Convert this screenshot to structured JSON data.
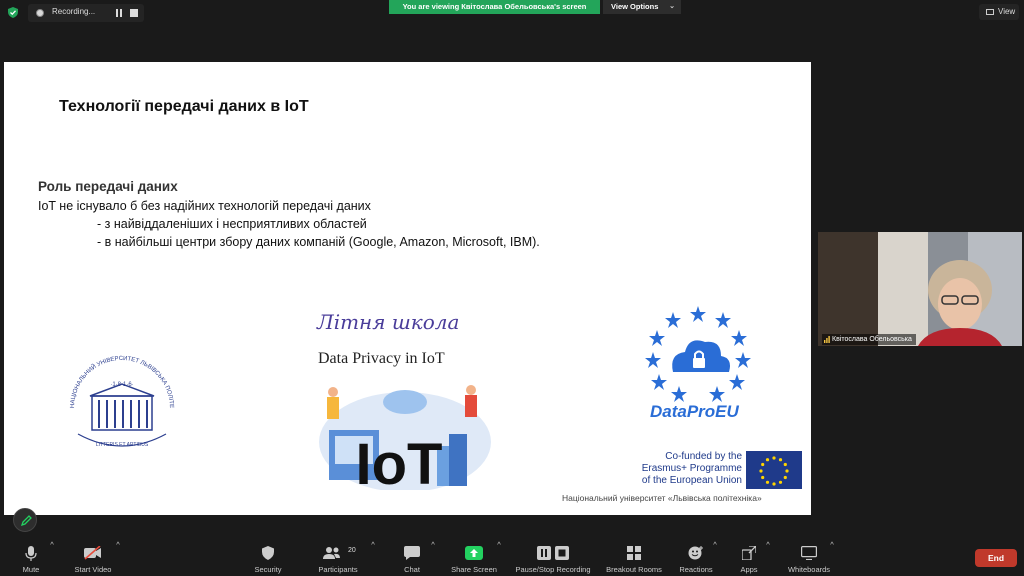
{
  "top": {
    "recording_label": "Recording...",
    "viewing_banner": "You are viewing Квітослава Обельовська's screen",
    "view_options": "View Options",
    "view_label": "View"
  },
  "slide": {
    "title": "Технології передачі даних в IoT",
    "section": "Роль передачі даних",
    "line1": "IoT не існувало б без надійних технологій передачі даних",
    "line2": "- з найвіддаленіших і несприятливих областей",
    "line3": "- в найбільші центри збору даних компаній (Google, Amazon, Microsoft, IBM).",
    "school_title": "Літня школа",
    "school_subtitle": "Data Privacy in IoT",
    "iot_text": "IoT",
    "dataproeu": "DataProEU",
    "cofunded_l1": "Co-funded by the",
    "cofunded_l2": "Erasmus+ Programme",
    "cofunded_l3": "of the European Union",
    "university": "Національний університет «Львівська політехніка»",
    "lp_logo_text": "НАЦІОНАЛЬНИЙ УНІВЕРСИТЕТ ЛЬВІВСЬКА ПОЛІТЕХНІКА",
    "lp_year": "·1·8·1·6·",
    "lp_motto": "LITTERIS ET ARTIBUS"
  },
  "participant": {
    "name": "Квітослава Обельовська"
  },
  "toolbar": {
    "mute": "Mute",
    "start_video": "Start Video",
    "security": "Security",
    "participants": "Participants",
    "participants_count": "20",
    "chat": "Chat",
    "share_screen": "Share Screen",
    "pause_stop": "Pause/Stop Recording",
    "breakout": "Breakout Rooms",
    "reactions": "Reactions",
    "apps": "Apps",
    "whiteboards": "Whiteboards",
    "end": "End"
  },
  "colors": {
    "banner_green": "#23a55a",
    "end_red": "#c0392b",
    "share_green": "#23d160",
    "slide_title_purple": "#4a3d9a",
    "dataproeu_blue": "#2a6dd6",
    "lp_blue": "#2c3f8f"
  }
}
